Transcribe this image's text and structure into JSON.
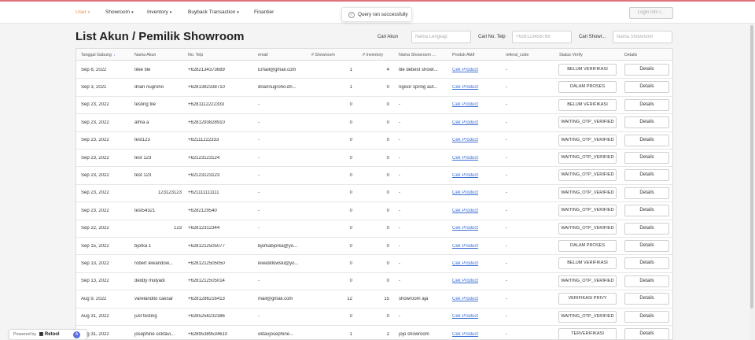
{
  "nav": {
    "items": [
      {
        "label": "User",
        "caret": "▾",
        "active": true
      },
      {
        "label": "Showroom",
        "caret": "▾",
        "active": false
      },
      {
        "label": "Inventory",
        "caret": "▾",
        "active": false
      },
      {
        "label": "Buyback Transaction",
        "caret": "▾",
        "active": false
      },
      {
        "label": "Finantier",
        "caret": "",
        "active": false
      }
    ],
    "login_label": "Login into r..."
  },
  "toast": {
    "icon": "check-circle-icon",
    "icon_glyph": "✓",
    "message": "Query ran successfully"
  },
  "page": {
    "title": "List Akun / Pemilik Showroom"
  },
  "filters": [
    {
      "label": "Cari Akun",
      "placeholder": "Nama Lengkap",
      "value": ""
    },
    {
      "label": "Cari No. Telp",
      "placeholder": "+628123456789",
      "value": ""
    },
    {
      "label": "Cari Showr...",
      "placeholder": "Nama Showroom",
      "value": ""
    }
  ],
  "table": {
    "columns": [
      "Tanggal Gabung",
      "Nama Akun",
      "No. Telp",
      "email",
      "# Showroom",
      "# Inventory",
      "Nama Showroom ...",
      "Produk Aktif",
      "referal_code",
      "Status Verify",
      "Details"
    ],
    "sort_icon": "↓",
    "rows": [
      {
        "date": "Sep 8, 2022",
        "name": "tilee tile",
        "phone": "+6282134373689",
        "email": "Email@gmail.com",
        "showroom": "1",
        "inventory": "4",
        "showroom_name": "tile debest showr...",
        "produk": "Cek Product",
        "referal": "-",
        "status": "BELUM VERIFIKASI",
        "details": "Details"
      },
      {
        "date": "Sep 3, 2021",
        "name": "drian nugroho",
        "phone": "+6281382338710",
        "email": "driannugroho.dn...",
        "showroom": "1",
        "inventory": "0",
        "showroom_name": "ngisor spring aut...",
        "produk": "Cek Product",
        "referal": "-",
        "status": "DALAM PROSES",
        "details": "Details"
      },
      {
        "date": "Sep 23, 2022",
        "name": "testing tile",
        "phone": "+6281112222333",
        "email": "-",
        "showroom": "0",
        "inventory": "0",
        "showroom_name": "-",
        "produk": "Cek Product",
        "referal": "-",
        "status": "BELUM VERIFIKASI",
        "details": "Details"
      },
      {
        "date": "Sep 23, 2022",
        "name": "afma a",
        "phone": "+6281293828910",
        "email": "-",
        "showroom": "0",
        "inventory": "0",
        "showroom_name": "-",
        "produk": "Cek Product",
        "referal": "-",
        "status": "WAITING_OTP_VERIFIED",
        "details": "Details"
      },
      {
        "date": "Sep 23, 2022",
        "name": "test123",
        "phone": "+62111222333",
        "email": "-",
        "showroom": "0",
        "inventory": "0",
        "showroom_name": "-",
        "produk": "Cek Product",
        "referal": "-",
        "status": "WAITING_OTP_VERIFIED",
        "details": "Details"
      },
      {
        "date": "Sep 23, 2022",
        "name": "test 123",
        "phone": "+62123123124",
        "email": "-",
        "showroom": "0",
        "inventory": "0",
        "showroom_name": "-",
        "produk": "Cek Product",
        "referal": "-",
        "status": "WAITING_OTP_VERIFIED",
        "details": "Details"
      },
      {
        "date": "Sep 23, 2022",
        "name": "test 123",
        "phone": "+62123123123",
        "email": "-",
        "showroom": "0",
        "inventory": "0",
        "showroom_name": "-",
        "produk": "Cek Product",
        "referal": "-",
        "status": "WAITING_OTP_VERIFIED",
        "details": "Details"
      },
      {
        "date": "Sep 23, 2022",
        "name": "123123123",
        "phone": "+621111111111",
        "email": "-",
        "showroom": "0",
        "inventory": "0",
        "showroom_name": "-",
        "produk": "Cek Product",
        "referal": "-",
        "status": "WAITING_OTP_VERIFIED",
        "details": "Details",
        "name_right": true
      },
      {
        "date": "Sep 23, 2022",
        "name": "test54321",
        "phone": "+6282129540",
        "email": "-",
        "showroom": "0",
        "inventory": "0",
        "showroom_name": "-",
        "produk": "Cek Product",
        "referal": "-",
        "status": "WAITING_OTP_VERIFIED",
        "details": "Details"
      },
      {
        "date": "Sep 22, 2022",
        "name": "123",
        "phone": "+62812312344",
        "email": "-",
        "showroom": "0",
        "inventory": "0",
        "showroom_name": "-",
        "produk": "Cek Product",
        "referal": "-",
        "status": "WAITING_OTP_VERIFIED",
        "details": "Details",
        "name_right": true
      },
      {
        "date": "Sep 15, 2022",
        "name": "bjorka 1",
        "phone": "+6281212505077",
        "email": "bjorkabjorka@yo...",
        "showroom": "0",
        "inventory": "0",
        "showroom_name": "-",
        "produk": "Cek Product",
        "referal": "-",
        "status": "DALAM PROSES",
        "details": "Details"
      },
      {
        "date": "Sep 13, 2022",
        "name": "robert lewandow...",
        "phone": "+6281212505050",
        "email": "lewa9dowski@yo...",
        "showroom": "0",
        "inventory": "0",
        "showroom_name": "-",
        "produk": "Cek Product",
        "referal": "-",
        "status": "BELUM VERIFIKASI",
        "details": "Details"
      },
      {
        "date": "Sep 13, 2022",
        "name": "deddy mulyadi",
        "phone": "+6281212505014",
        "email": "-",
        "showroom": "0",
        "inventory": "0",
        "showroom_name": "-",
        "produk": "Cek Product",
        "referal": "-",
        "status": "WAITING_OTP_VERIFIED",
        "details": "Details"
      },
      {
        "date": "Aug 9, 2022",
        "name": "varelandito caesar",
        "phone": "+6281286216413",
        "email": "mail@gmail.com",
        "showroom": "12",
        "inventory": "15",
        "showroom_name": "showroom aja",
        "produk": "Cek Product",
        "referal": "-",
        "status": "VERIFIKASI PRIVY",
        "details": "Details"
      },
      {
        "date": "Aug 31, 2022",
        "name": "just testing",
        "phone": "+6285256232386",
        "email": "-",
        "showroom": "0",
        "inventory": "0",
        "showroom_name": "-",
        "produk": "Cek Product",
        "referal": "-",
        "status": "WAITING_OTP_VERIFIED",
        "details": "Details"
      },
      {
        "date": "Aug 31, 2022",
        "name": "josephine ocktavi...",
        "phone": "+6289538953461​0",
        "email": "oktavjosephine...",
        "showroom": "1",
        "inventory": "2",
        "showroom_name": "jojo showroom",
        "produk": "Cek Product",
        "referal": "-",
        "status": "TERVERIFIKASI",
        "details": "Details"
      }
    ]
  },
  "footer": {
    "powered_by": "Powered by",
    "brand": "Retool",
    "brand_icon": "retool-logo-icon",
    "avatar_initial": "A"
  }
}
